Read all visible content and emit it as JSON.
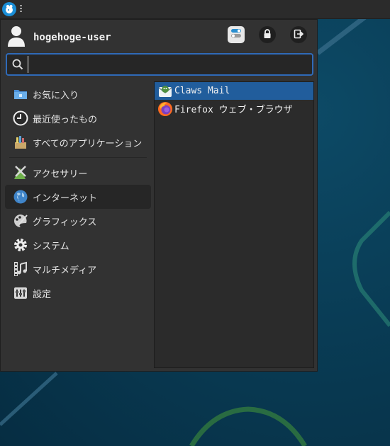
{
  "panel": {
    "menu_button_icon": "whisker-menu-icon"
  },
  "menu": {
    "user": {
      "name": "hogehoge-user",
      "avatar_icon": "user-icon"
    },
    "actions": [
      {
        "name": "settings-manager",
        "icon": "toggle-settings-icon"
      },
      {
        "name": "lock-screen",
        "icon": "lock-icon"
      },
      {
        "name": "log-out",
        "icon": "logout-icon"
      }
    ],
    "search": {
      "value": "",
      "placeholder": ""
    },
    "categories": [
      {
        "label": "お気に入り",
        "icon": "favorites-folder-icon"
      },
      {
        "label": "最近使ったもの",
        "icon": "clock-icon"
      },
      {
        "label": "すべてのアプリケーション",
        "icon": "all-apps-icon"
      },
      {
        "label": "アクセサリー",
        "icon": "accessories-icon"
      },
      {
        "label": "インターネット",
        "icon": "internet-globe-icon",
        "active": true
      },
      {
        "label": "グラフィックス",
        "icon": "graphics-palette-icon"
      },
      {
        "label": "システム",
        "icon": "system-gear-icon"
      },
      {
        "label": "マルチメディア",
        "icon": "multimedia-film-icon"
      },
      {
        "label": "設定",
        "icon": "settings-icon"
      }
    ],
    "apps": [
      {
        "label": "Claws Mail",
        "icon": "claws-mail-icon",
        "selected": true
      },
      {
        "label": "Firefox ウェブ・ブラウザ",
        "icon": "firefox-icon"
      }
    ]
  },
  "colors": {
    "accent": "#2f6ab8",
    "selection": "#215d9c",
    "panel_bg": "#2b2b2b",
    "menu_bg": "#323232"
  }
}
